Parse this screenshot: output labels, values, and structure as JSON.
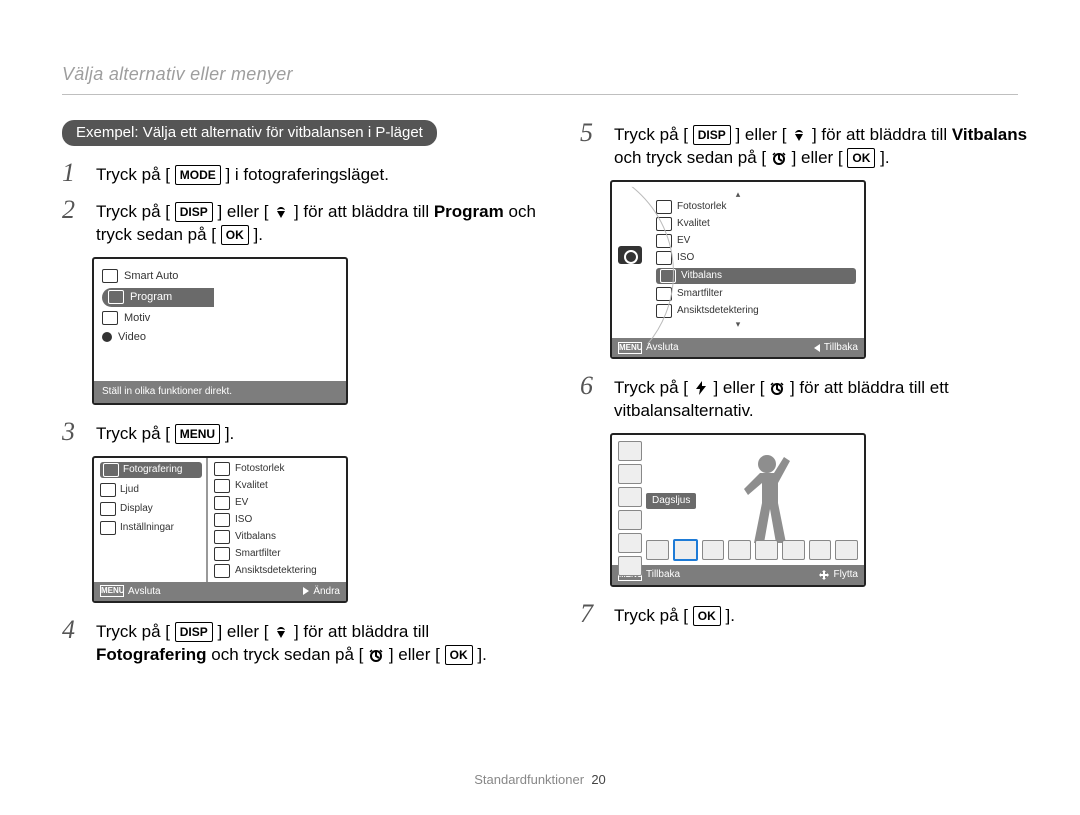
{
  "header": {
    "title": "Välja alternativ eller menyer"
  },
  "example": {
    "pill": "Exempel: Välja ett alternativ för vitbalansen i P-läget"
  },
  "labels": {
    "mode": "MODE",
    "menu": "MENU",
    "disp": "DISP",
    "ok": "OK",
    "menu_badge": "MENU"
  },
  "steps": {
    "s1": {
      "n": "1",
      "a": "Tryck på [",
      "b": "] i fotograferingsläget."
    },
    "s2": {
      "n": "2",
      "a": "Tryck på [",
      "b": "] eller [",
      "c": "] för att bläddra till ",
      "tgt": "Program",
      "d": " och tryck sedan på [",
      "e": "]."
    },
    "s3": {
      "n": "3",
      "a": "Tryck på [",
      "b": "]."
    },
    "s4": {
      "n": "4",
      "a": "Tryck på [",
      "b": "] eller [",
      "c": "] för att bläddra till ",
      "tgt": "Fotografering",
      "d": " och tryck sedan på [",
      "e": "] eller [",
      "f": "]."
    },
    "s5": {
      "n": "5",
      "a": "Tryck på [",
      "b": "] eller [",
      "c": "] för att bläddra till ",
      "tgt": "Vitbalans",
      "d": " och tryck sedan på [",
      "e": "] eller [",
      "f": "]."
    },
    "s6": {
      "n": "6",
      "a": "Tryck på [",
      "b": "] eller [",
      "c": "] för att bläddra till ett vitbalansalternativ."
    },
    "s7": {
      "n": "7",
      "a": "Tryck på [",
      "b": "]."
    }
  },
  "shot1": {
    "items": [
      "Smart Auto",
      "Program",
      "Motiv",
      "Video"
    ],
    "footer": "Ställ in olika funktioner direkt."
  },
  "shot2": {
    "left": [
      "Fotografering",
      "Ljud",
      "Display",
      "Inställningar"
    ],
    "right": [
      "Fotostorlek",
      "Kvalitet",
      "EV",
      "ISO",
      "Vitbalans",
      "Smartfilter",
      "Ansiktsdetektering"
    ],
    "footer_l": "Avsluta",
    "footer_r": "Ändra"
  },
  "shot3": {
    "items": [
      "Fotostorlek",
      "Kvalitet",
      "EV",
      "ISO",
      "Vitbalans",
      "Smartfilter",
      "Ansiktsdetektering"
    ],
    "selected": "Vitbalans",
    "footer_l": "Avsluta",
    "footer_r": "Tillbaka"
  },
  "shot4": {
    "selected": "Dagsljus",
    "footer_l": "Tillbaka",
    "footer_r": "Flytta"
  },
  "footer": {
    "section": "Standardfunktioner",
    "page": "20"
  }
}
